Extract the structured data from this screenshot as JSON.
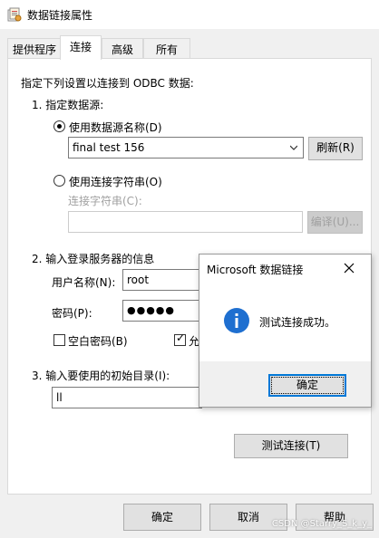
{
  "window": {
    "title": "数据链接属性",
    "icon": "data-link-icon"
  },
  "tabs": [
    {
      "label": "提供程序",
      "active": false
    },
    {
      "label": "连接",
      "active": true
    },
    {
      "label": "高级",
      "active": false
    },
    {
      "label": "所有",
      "active": false
    }
  ],
  "connection": {
    "intro": "指定下列设置以连接到 ODBC 数据:",
    "step1": "1. 指定数据源:",
    "use_dsn_label": "使用数据源名称(D)",
    "dsn_value": "final test 156",
    "refresh_button": "刷新(R)",
    "use_connstr_label": "使用连接字符串(O)",
    "connstr_label": "连接字符串(C):",
    "connstr_value": "",
    "build_button": "编译(U)...",
    "step2": "2. 输入登录服务器的信息",
    "username_label": "用户名称(N):",
    "username_value": "root",
    "password_label": "密码(P):",
    "password_value": "●●●●●",
    "blank_password_label": "空白密码(B)",
    "allow_save_label": "允",
    "step3": "3. 输入要使用的初始目录(I):",
    "catalog_value": "ll",
    "test_button": "测试连接(T)"
  },
  "footer": {
    "ok": "确定",
    "cancel": "取消",
    "help": "帮助"
  },
  "message_box": {
    "title": "Microsoft 数据链接",
    "message": "测试连接成功。",
    "ok": "确定",
    "icon": "info-icon"
  },
  "watermark": "CSDN @Starry_S_k_y_",
  "colors": {
    "accent": "#0078d7",
    "info_icon": "#1e6fd0"
  }
}
